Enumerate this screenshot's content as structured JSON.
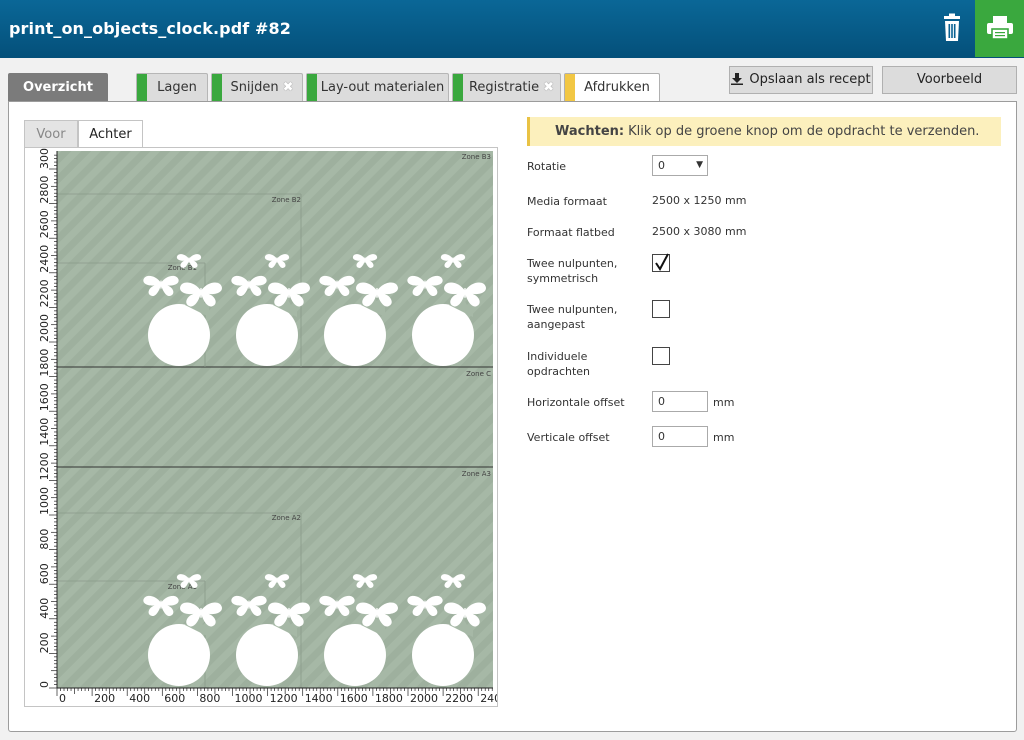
{
  "window": {
    "title": "print_on_objects_clock.pdf #82"
  },
  "tabs": [
    {
      "label": "Overzicht"
    },
    {
      "label": "Lagen",
      "status_color": "#3aa83e"
    },
    {
      "label": "Snijden",
      "status_color": "#3aa83e",
      "removable": true
    },
    {
      "label": "Lay-out materialen",
      "status_color": "#3aa83e"
    },
    {
      "label": "Registratie",
      "status_color": "#3aa83e",
      "removable": true
    },
    {
      "label": "Afdrukken",
      "status_color": "#f2c744",
      "active": true
    }
  ],
  "toolbar": {
    "save_recipe_label": "Opslaan als recept",
    "preview_label": "Voorbeeld"
  },
  "preview": {
    "side_tabs": [
      "Voor",
      "Achter"
    ],
    "active_side": "Achter",
    "background_color": "#a6b8a6",
    "y_ticks": [
      "0",
      "200",
      "400",
      "600",
      "800",
      "1000",
      "1200",
      "1400",
      "1600",
      "1800",
      "2000",
      "2200",
      "2400",
      "2600",
      "2800",
      "3000"
    ],
    "x_ticks": [
      "0",
      "200",
      "400",
      "600",
      "800",
      "1000",
      "1200",
      "1400",
      "1600",
      "1800",
      "2000",
      "2200",
      "240"
    ],
    "zones": {
      "top": [
        "Zone B3",
        "Zone B2",
        "Zone B1"
      ],
      "middle": "Zone C",
      "bottom": [
        "Zone A3",
        "Zone A2",
        "Zone A1"
      ]
    }
  },
  "warning": {
    "bold": "Wachten:",
    "text": "Klik op de groene knop om de opdracht te verzenden."
  },
  "form": {
    "rotation": {
      "label": "Rotatie",
      "value": "0"
    },
    "media_format": {
      "label": "Media formaat",
      "value": "2500 x 1250 mm"
    },
    "flatbed_format": {
      "label": "Formaat flatbed",
      "value": "2500 x 3080 mm"
    },
    "two_zeros_symmetric": {
      "label_1": "Twee nulpunten,",
      "label_2": "symmetrisch",
      "checked": true
    },
    "two_zeros_custom": {
      "label_1": "Twee nulpunten,",
      "label_2": "aangepast",
      "checked": false
    },
    "individual_jobs": {
      "label_1": "Individuele",
      "label_2": "opdrachten",
      "checked": false
    },
    "horizontal_offset": {
      "label": "Horizontale offset",
      "value": "0",
      "unit": "mm"
    },
    "vertical_offset": {
      "label": "Verticale offset",
      "value": "0",
      "unit": "mm"
    }
  }
}
